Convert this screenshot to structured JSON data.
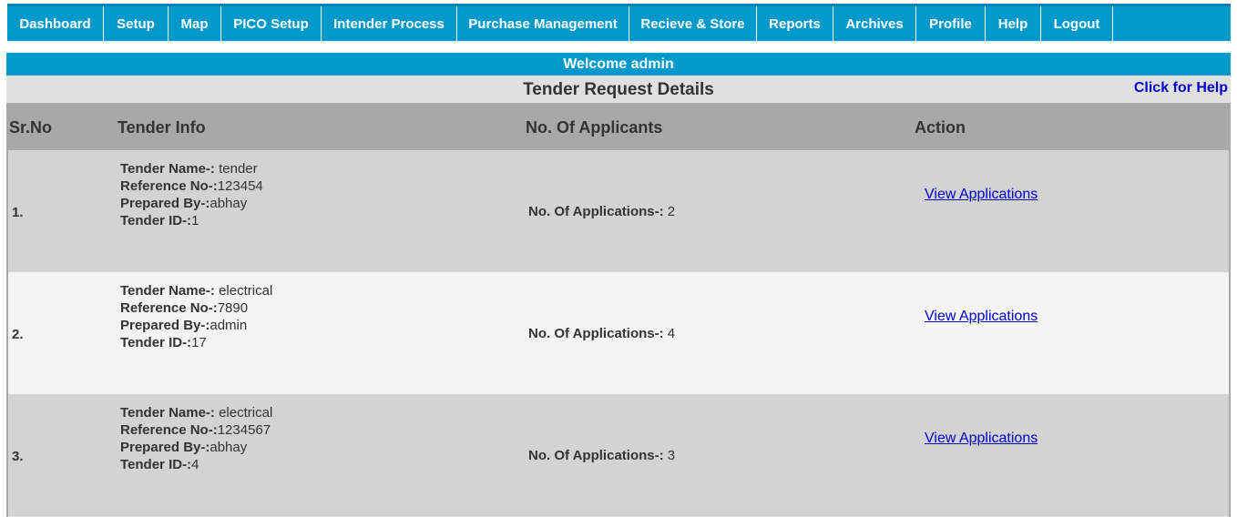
{
  "nav": {
    "items": [
      {
        "label": "Dashboard"
      },
      {
        "label": "Setup"
      },
      {
        "label": "Map"
      },
      {
        "label": "PICO Setup"
      },
      {
        "label": "Intender Process"
      },
      {
        "label": "Purchase Management"
      },
      {
        "label": "Recieve & Store"
      },
      {
        "label": "Reports"
      },
      {
        "label": "Archives"
      },
      {
        "label": "Profile"
      },
      {
        "label": "Help"
      },
      {
        "label": "Logout"
      }
    ]
  },
  "welcome": "Welcome admin",
  "page": {
    "title": "Tender Request Details",
    "help_link": "Click for Help"
  },
  "table": {
    "headers": {
      "sr_no": "Sr.No",
      "tender_info": "Tender Info",
      "applicants": "No. Of Applicants",
      "action": "Action"
    },
    "labels": {
      "tender_name": "Tender Name-:",
      "reference_no": "Reference No-:",
      "prepared_by": "Prepared By-:",
      "tender_id": "Tender ID-:",
      "applications": "No. Of Applications-:",
      "view_link": "View Applications"
    },
    "rows": [
      {
        "sr": "1.",
        "tender_name": " tender",
        "reference_no": "123454",
        "prepared_by": "abhay",
        "tender_id": "1",
        "applications": " 2"
      },
      {
        "sr": "2.",
        "tender_name": " electrical",
        "reference_no": "7890",
        "prepared_by": "admin",
        "tender_id": "17",
        "applications": " 4"
      },
      {
        "sr": "3.",
        "tender_name": " electrical",
        "reference_no": "1234567",
        "prepared_by": "abhay",
        "tender_id": "4",
        "applications": " 3"
      }
    ]
  },
  "colors": {
    "nav_bg": "#0099cc",
    "header_bg": "#a8a8a8",
    "row_odd": "#d3d3d3",
    "row_even": "#f4f4f4",
    "link": "#0000cc"
  }
}
